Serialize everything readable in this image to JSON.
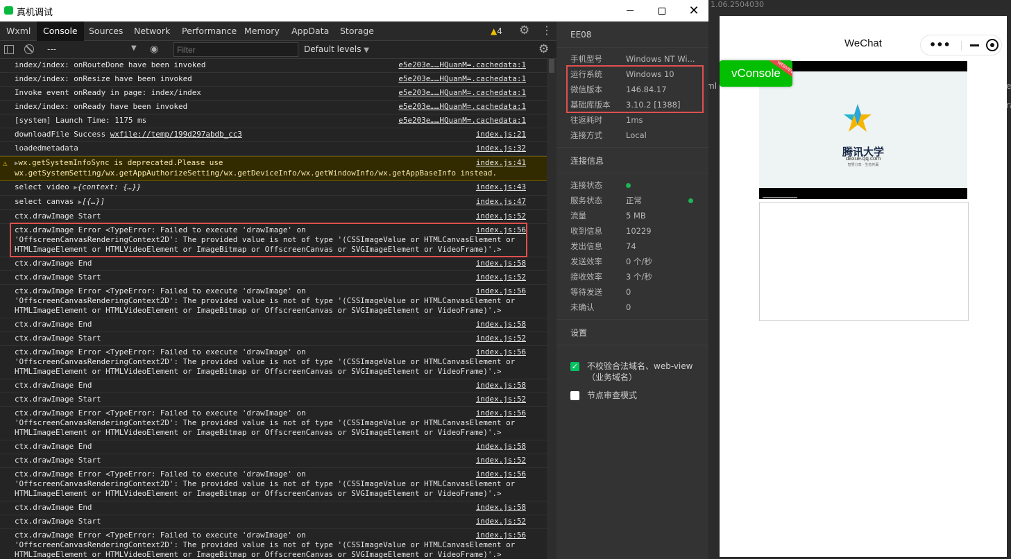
{
  "window": {
    "title": "真机调试"
  },
  "tabs": {
    "items": [
      "Wxml",
      "Console",
      "Sources",
      "Network",
      "Performance",
      "Memory",
      "AppData",
      "Storage"
    ],
    "active": "Console",
    "warning_count": "4"
  },
  "filterbar": {
    "context": "---",
    "filter_placeholder": "Filter",
    "levels": "Default levels"
  },
  "console": {
    "rows": [
      {
        "msg": "index/index: onRouteDone have been invoked",
        "src": "e5e203e……HQuanM=.cachedata:1"
      },
      {
        "msg": "index/index: onResize have been invoked",
        "src": "e5e203e……HQuanM=.cachedata:1"
      },
      {
        "msg": "Invoke event onReady in page: index/index",
        "src": "e5e203e……HQuanM=.cachedata:1"
      },
      {
        "msg": "index/index: onReady have been invoked",
        "src": "e5e203e……HQuanM=.cachedata:1"
      },
      {
        "msg": "[system] Launch Time: 1175 ms",
        "src": "e5e203e……HQuanM=.cachedata:1"
      },
      {
        "msg": "downloadFile Success ",
        "link": "wxfile://temp/199d297abdb_cc3",
        "src": "index.js:21"
      },
      {
        "msg": "loadedmetadata",
        "src": "index.js:32"
      },
      {
        "msg": "wx.getSystemInfoSync is deprecated.Please use\nwx.getSystemSetting/wx.getAppAuthorizeSetting/wx.getDeviceInfo/wx.getWindowInfo/wx.getAppBaseInfo instead.",
        "src": "index.js:41",
        "level": "warn"
      },
      {
        "msg": "select video ",
        "obj": "{context: {…}}",
        "src": "index.js:43"
      },
      {
        "msg": "select canvas ",
        "obj": "[{…}]",
        "src": "index.js:47"
      },
      {
        "msg": "ctx.drawImage Start",
        "src": "index.js:52"
      },
      {
        "msg": "ctx.drawImage Error <TypeError: Failed to execute 'drawImage' on\n'OffscreenCanvasRenderingContext2D': The provided value is not of type '(CSSImageValue or HTMLCanvasElement or\nHTMLImageElement or HTMLVideoElement or ImageBitmap or OffscreenCanvas or SVGImageElement or VideoFrame)'.>",
        "src": "index.js:56",
        "highlight": true
      },
      {
        "msg": "ctx.drawImage End",
        "src": "index.js:58"
      },
      {
        "msg": "ctx.drawImage Start",
        "src": "index.js:52"
      },
      {
        "msg": "ctx.drawImage Error <TypeError: Failed to execute 'drawImage' on\n'OffscreenCanvasRenderingContext2D': The provided value is not of type '(CSSImageValue or HTMLCanvasElement or\nHTMLImageElement or HTMLVideoElement or ImageBitmap or OffscreenCanvas or SVGImageElement or VideoFrame)'.>",
        "src": "index.js:56"
      },
      {
        "msg": "ctx.drawImage End",
        "src": "index.js:58"
      },
      {
        "msg": "ctx.drawImage Start",
        "src": "index.js:52"
      },
      {
        "msg": "ctx.drawImage Error <TypeError: Failed to execute 'drawImage' on\n'OffscreenCanvasRenderingContext2D': The provided value is not of type '(CSSImageValue or HTMLCanvasElement or\nHTMLImageElement or HTMLVideoElement or ImageBitmap or OffscreenCanvas or SVGImageElement or VideoFrame)'.>",
        "src": "index.js:56"
      },
      {
        "msg": "ctx.drawImage End",
        "src": "index.js:58"
      },
      {
        "msg": "ctx.drawImage Start",
        "src": "index.js:52"
      },
      {
        "msg": "ctx.drawImage Error <TypeError: Failed to execute 'drawImage' on\n'OffscreenCanvasRenderingContext2D': The provided value is not of type '(CSSImageValue or HTMLCanvasElement or\nHTMLImageElement or HTMLVideoElement or ImageBitmap or OffscreenCanvas or SVGImageElement or VideoFrame)'.>",
        "src": "index.js:56"
      },
      {
        "msg": "ctx.drawImage End",
        "src": "index.js:58"
      },
      {
        "msg": "ctx.drawImage Start",
        "src": "index.js:52"
      },
      {
        "msg": "ctx.drawImage Error <TypeError: Failed to execute 'drawImage' on\n'OffscreenCanvasRenderingContext2D': The provided value is not of type '(CSSImageValue or HTMLCanvasElement or\nHTMLImageElement or HTMLVideoElement or ImageBitmap or OffscreenCanvas or SVGImageElement or VideoFrame)'.>",
        "src": "index.js:56"
      },
      {
        "msg": "ctx.drawImage End",
        "src": "index.js:58"
      },
      {
        "msg": "ctx.drawImage Start",
        "src": "index.js:52"
      },
      {
        "msg": "ctx.drawImage Error <TypeError: Failed to execute 'drawImage' on\n'OffscreenCanvasRenderingContext2D': The provided value is not of type '(CSSImageValue or HTMLCanvasElement or\nHTMLImageElement or HTMLVideoElement or ImageBitmap or OffscreenCanvas or SVGImageElement or VideoFrame)'.>",
        "src": "index.js:56"
      }
    ]
  },
  "panel": {
    "device_id": "EE08",
    "device": [
      {
        "k": "手机型号",
        "v": "Windows NT Wi..."
      },
      {
        "k": "运行系统",
        "v": "Windows 10"
      },
      {
        "k": "微信版本",
        "v": "146.84.17"
      },
      {
        "k": "基础库版本",
        "v": "3.10.2 [1388]"
      },
      {
        "k": "往返耗时",
        "v": "1ms"
      },
      {
        "k": "连接方式",
        "v": "Local"
      }
    ],
    "conn_title": "连接信息",
    "conn": [
      {
        "k": "连接状态",
        "v": ""
      },
      {
        "k": "服务状态",
        "v": "正常"
      },
      {
        "k": "流量",
        "v": "5 MB"
      },
      {
        "k": "收到信息",
        "v": "10229"
      },
      {
        "k": "发出信息",
        "v": "74"
      },
      {
        "k": "发送效率",
        "v": "0 个/秒"
      },
      {
        "k": "接收效率",
        "v": "3 个/秒"
      },
      {
        "k": "等待发送",
        "v": "0"
      },
      {
        "k": "未确认",
        "v": "0"
      }
    ],
    "settings_title": "设置",
    "checks": [
      {
        "label": "不校验合法域名、web-view（业务域名）",
        "checked": true
      },
      {
        "label": "节点审查模式",
        "checked": false
      }
    ]
  },
  "simulator": {
    "version": "1.06.2504030",
    "nav_title": "WeChat",
    "vconsole_label": "vConsole",
    "vconsole_badge": "WEBVIEW",
    "video_brand": "腾讯大学",
    "video_url": "daxue.qq.com",
    "video_slogan": "智慧分享 · 生态共赢",
    "edge_fragments": [
      "ml",
      "e",
      "ra"
    ]
  },
  "colors": {
    "highlight": "#e04f4f",
    "accent_green": "#07c160",
    "warn_bg": "#332b00"
  }
}
